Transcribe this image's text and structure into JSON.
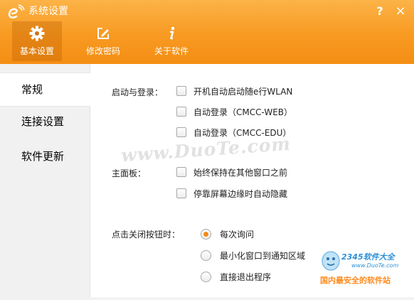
{
  "window": {
    "title": "系统设置"
  },
  "tabs": [
    {
      "label": "基本设置",
      "icon": "gear-icon"
    },
    {
      "label": "修改密码",
      "icon": "edit-icon"
    },
    {
      "label": "关于软件",
      "icon": "info-icon"
    }
  ],
  "nav": [
    {
      "label": "常规"
    },
    {
      "label": "连接设置"
    },
    {
      "label": "软件更新"
    }
  ],
  "sections": {
    "startup": {
      "label": "启动与登录：",
      "options": [
        "开机自动启动随e行WLAN",
        "自动登录（CMCC-WEB）",
        "自动登录（CMCC-EDU）"
      ]
    },
    "main_panel": {
      "label": "主面板：",
      "options": [
        "始终保持在其他窗口之前",
        "停靠屏幕边缘时自动隐藏"
      ]
    },
    "close_action": {
      "label": "点击关闭按钮时：",
      "options": [
        "每次询问",
        "最小化窗口到通知区域",
        "直接退出程序"
      ],
      "selected": 0
    }
  },
  "watermark": {
    "text": "www.DuoTe.com",
    "badge_brand": "2345软件大全",
    "badge_url": "www.DuoTe.com",
    "badge_slogan": "国内最安全的软件站"
  },
  "colors": {
    "accent": "#f89a22",
    "radio_dot": "#f58a12"
  }
}
